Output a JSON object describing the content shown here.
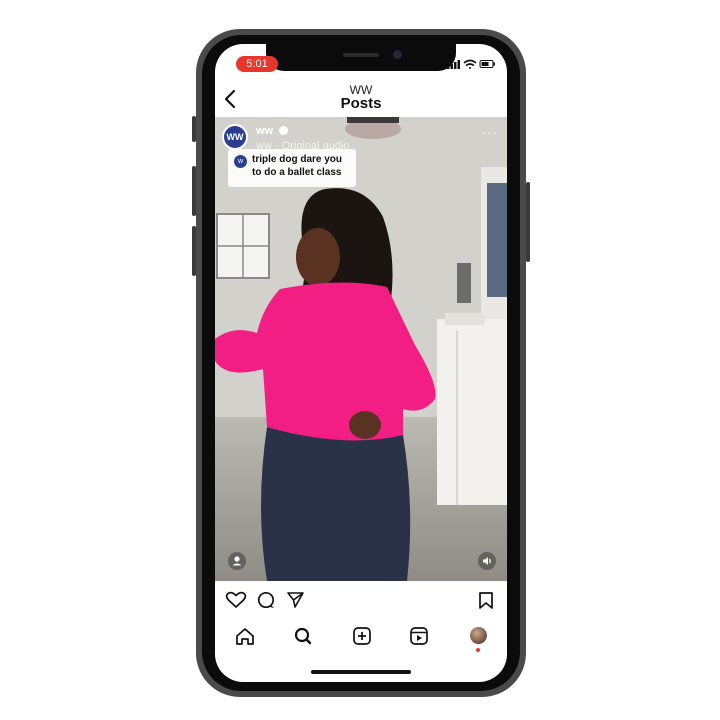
{
  "status_bar": {
    "time": "5:01"
  },
  "header": {
    "account": "WW",
    "title": "Posts"
  },
  "post": {
    "username": "ww",
    "audio": "ww · Original audio",
    "caption": "triple dog dare you to do a ballet class"
  },
  "colors": {
    "time_pill": "#e8362c",
    "brand_blue": "#2a3f8f",
    "shirt": "#f21e83",
    "leggings": "#2a3248",
    "phone_frame": "#4a4a4a"
  },
  "icons": {
    "actions": [
      "heart-icon",
      "comment-icon",
      "share-icon",
      "save-icon"
    ],
    "nav": [
      "home-icon",
      "search-icon",
      "create-icon",
      "reels-icon",
      "profile-icon"
    ]
  }
}
